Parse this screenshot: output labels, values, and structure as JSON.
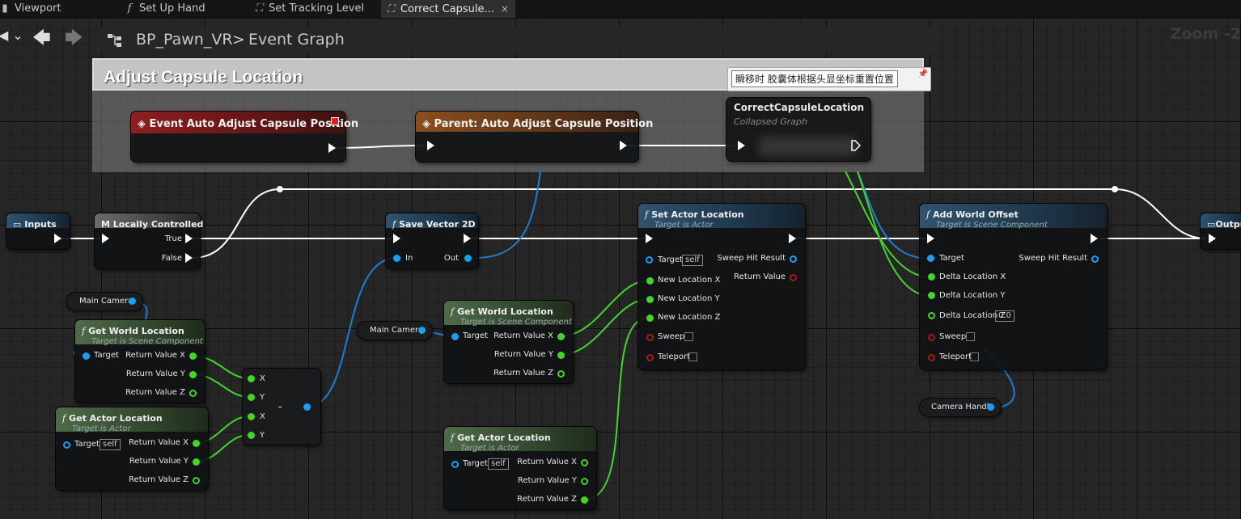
{
  "tabs": [
    {
      "label": "Viewport",
      "icon": "viewport-icon"
    },
    {
      "label": "Set Up Hand",
      "icon": "function-icon"
    },
    {
      "label": "Set Tracking Level",
      "icon": "graph-icon"
    },
    {
      "label": "Correct Capsule...",
      "icon": "graph-icon",
      "close": "×"
    }
  ],
  "breadcrumb": {
    "blueprint": "BP_Pawn_VR",
    "sep": ">",
    "graph": "Event Graph"
  },
  "zoom": "Zoom -2",
  "comment": {
    "title": "Adjust Capsule Location",
    "bubble": "瞬移时 胶囊体根据头显坐标重置位置"
  },
  "nodes": {
    "event": {
      "title": "Event Auto Adjust Capsule Position"
    },
    "parent": {
      "title": "Parent: Auto Adjust Capsule Position"
    },
    "collapsed": {
      "title": "CorrectCapsuleLocation",
      "subtitle": "Collapsed Graph"
    },
    "inputs": {
      "title": "Inputs"
    },
    "locally": {
      "title": "Locally Controlled",
      "pins": [
        "True",
        "False"
      ]
    },
    "save": {
      "title": "Save Vector 2D",
      "in": "In",
      "out": "Out"
    },
    "setloc": {
      "title": "Set Actor Location",
      "subtitle": "Target is Actor",
      "target": "Target",
      "self": "self",
      "sweephit": "Sweep Hit Result",
      "retval": "Return Value",
      "pins": [
        "New Location X",
        "New Location Y",
        "New Location Z",
        "Sweep",
        "Teleport"
      ]
    },
    "addoff": {
      "title": "Add World Offset",
      "subtitle": "Target is Scene Component",
      "target": "Target",
      "sweephit": "Sweep Hit Result",
      "pins": [
        "Delta Location X",
        "Delta Location Y",
        "Delta Location Z",
        "Sweep",
        "Teleport"
      ],
      "z_value": "0.0"
    },
    "output": {
      "title": "Outpu"
    },
    "gwl1": {
      "title": "Get World Location",
      "subtitle": "Target is Scene Component",
      "target": "Target",
      "outs": [
        "Return Value X",
        "Return Value Y",
        "Return Value Z"
      ]
    },
    "gal1": {
      "title": "Get Actor Location",
      "subtitle": "Target is Actor",
      "target": "Target",
      "self": "self",
      "outs": [
        "Return Value X",
        "Return Value Y",
        "Return Value Z"
      ]
    },
    "minus": {
      "pins": [
        "X",
        "Y",
        "X",
        "Y"
      ],
      "op": "-"
    },
    "gwl2": {
      "title": "Get World Location",
      "subtitle": "Target is Scene Component",
      "target": "Target",
      "outs": [
        "Return Value X",
        "Return Value Y",
        "Return Value Z"
      ]
    },
    "gal2": {
      "title": "Get Actor Location",
      "subtitle": "Target is Actor",
      "target": "Target",
      "self": "self",
      "outs": [
        "Return Value X",
        "Return Value Y",
        "Return Value Z"
      ]
    }
  },
  "vars": {
    "camera1": "Main Camera",
    "camera2": "Main Camera",
    "handle": "Camera Handle"
  },
  "colors": {
    "exec": "#ffffff",
    "object": "#1e9ef2",
    "float": "#45d42a",
    "bool": "#a51b1b"
  }
}
